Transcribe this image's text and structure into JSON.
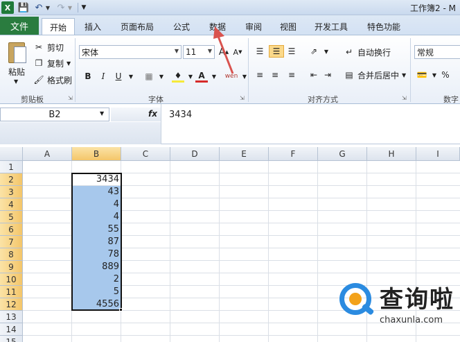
{
  "titlebar": {
    "logo": "X",
    "window_title": "工作簿2 - M"
  },
  "tabs": {
    "file": "文件",
    "items": [
      "开始",
      "插入",
      "页面布局",
      "公式",
      "数据",
      "审阅",
      "视图",
      "开发工具",
      "特色功能"
    ],
    "active": "开始"
  },
  "ribbon": {
    "clipboard": {
      "paste": "粘贴",
      "cut": "剪切",
      "copy": "复制",
      "format_painter": "格式刷",
      "group_label": "剪贴板"
    },
    "font": {
      "font_name": "宋体",
      "font_size": "11",
      "bold": "B",
      "italic": "I",
      "underline": "U",
      "font_color_glyph": "A",
      "grow": "A",
      "shrink": "A",
      "phonetic": "wén",
      "group_label": "字体"
    },
    "alignment": {
      "wrap_text": "自动换行",
      "merge_center": "合并后居中",
      "group_label": "对齐方式"
    },
    "number": {
      "format": "常规",
      "percent": "%",
      "group_label": "数字"
    }
  },
  "formula_bar": {
    "name_box": "B2",
    "fx": "fx",
    "value": "3434"
  },
  "grid": {
    "columns": [
      "A",
      "B",
      "C",
      "D",
      "E",
      "F",
      "G",
      "H",
      "I"
    ],
    "rows": [
      "1",
      "2",
      "3",
      "4",
      "5",
      "6",
      "7",
      "8",
      "9",
      "10",
      "11",
      "12",
      "13",
      "14",
      "15"
    ],
    "selected_column": "B",
    "column_b_values": [
      "3434",
      "43",
      "4",
      "4",
      "55",
      "87",
      "78",
      "889",
      "2",
      "5",
      "4556"
    ]
  },
  "watermark": {
    "text": "查询啦",
    "url": "chaxunla.com"
  },
  "colors": {
    "file_tab": "#2a7c3f",
    "selection_fill": "#a7c8ec",
    "annotation_arrow": "#d9534f"
  }
}
